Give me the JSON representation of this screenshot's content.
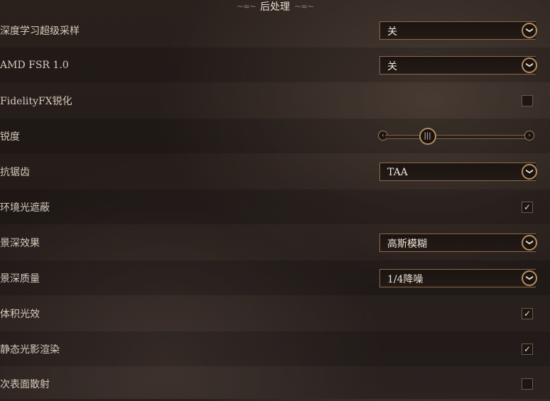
{
  "header": {
    "title": "后处理",
    "flourish_left": "~≈~",
    "flourish_right": "~≈~"
  },
  "icons": {
    "chevron": "❯",
    "check": "✓",
    "slider_left": "‹",
    "slider_right": "›",
    "slider_knob": "|||"
  },
  "settings": {
    "dlss": {
      "label": "深度学习超级采样",
      "value": "关"
    },
    "fsr": {
      "label": "AMD FSR 1.0",
      "value": "关"
    },
    "fidelityfx": {
      "label": "FidelityFX锐化",
      "checked": false
    },
    "sharpness": {
      "label": "锐度",
      "level": 0.27
    },
    "antialiasing": {
      "label": "抗锯齿",
      "value": "TAA"
    },
    "ambient_occlusion": {
      "label": "环境光遮蔽",
      "checked": true
    },
    "depth_of_field": {
      "label": "景深效果",
      "value": "高斯模糊"
    },
    "dof_quality": {
      "label": "景深质量",
      "value": "1/4降噪"
    },
    "volumetric_lighting": {
      "label": "体积光效",
      "checked": true
    },
    "static_lighting": {
      "label": "静态光影渲染",
      "checked": true
    },
    "subsurface_scattering": {
      "label": "次表面散射",
      "checked": false
    }
  }
}
